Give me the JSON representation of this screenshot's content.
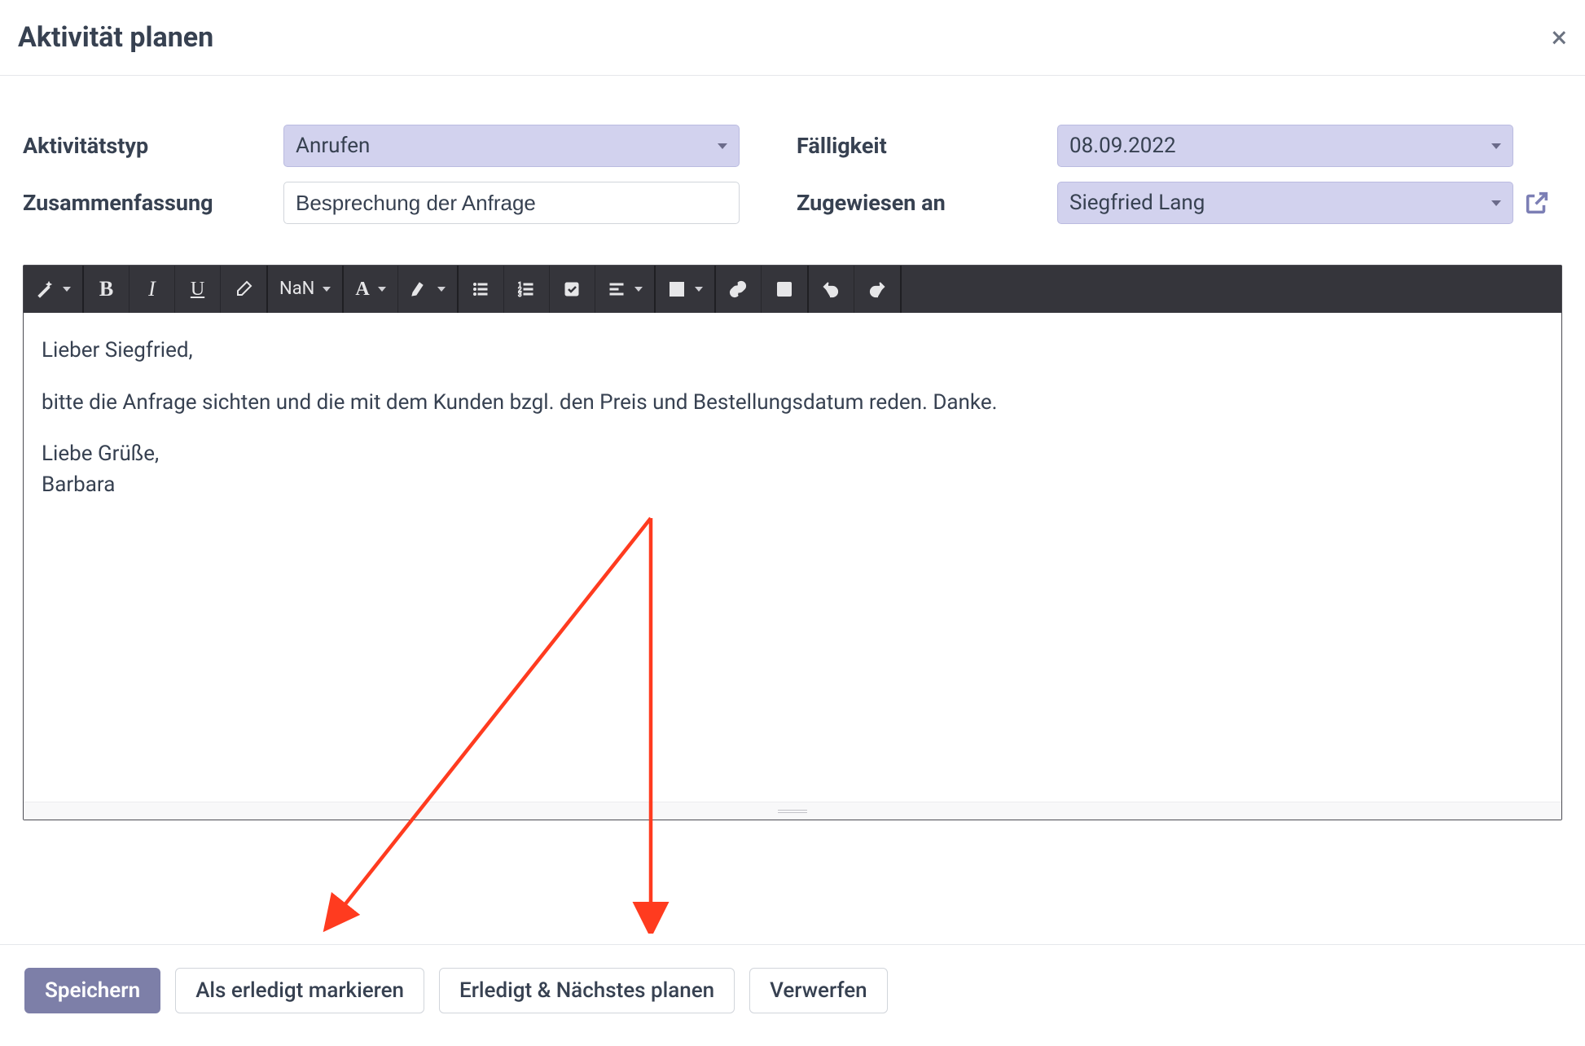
{
  "dialog": {
    "title": "Aktivität planen"
  },
  "fields": {
    "activity_type_label": "Aktivitätstyp",
    "activity_type_value": "Anrufen",
    "summary_label": "Zusammenfassung",
    "summary_value": "Besprechung der Anfrage",
    "due_label": "Fälligkeit",
    "due_value": "08.09.2022",
    "assigned_label": "Zugewiesen an",
    "assigned_value": "Siegfried Lang"
  },
  "toolbar": {
    "font_size_label": "NaN"
  },
  "editor": {
    "line1": "Lieber Siegfried,",
    "line2": "bitte die Anfrage sichten und die mit dem Kunden bzgl. den Preis und Bestellungsdatum reden. Danke.",
    "line3": "Liebe Grüße,\nBarbara"
  },
  "buttons": {
    "save": "Speichern",
    "mark_done": "Als erledigt markieren",
    "done_next": "Erledigt & Nächstes planen",
    "discard": "Verwerfen"
  }
}
